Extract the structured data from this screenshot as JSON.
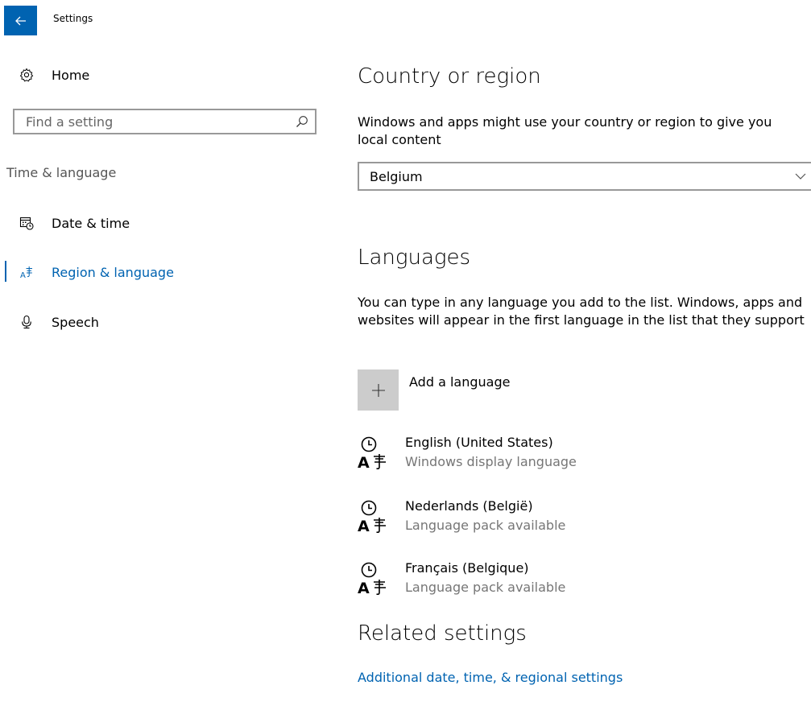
{
  "window": {
    "title": "Settings"
  },
  "nav": {
    "home_label": "Home",
    "search_placeholder": "Find a setting",
    "search_value": "",
    "group_label": "Time & language",
    "items": [
      {
        "label": "Date & time",
        "icon": "calendar-clock-icon",
        "selected": false
      },
      {
        "label": "Region & language",
        "icon": "region-language-icon",
        "selected": true
      },
      {
        "label": "Speech",
        "icon": "microphone-icon",
        "selected": false
      }
    ]
  },
  "region": {
    "heading": "Country or region",
    "description": "Windows and apps might use your country or region to give you local content",
    "selected_country": "Belgium"
  },
  "languages": {
    "heading": "Languages",
    "description": "You can type in any language you add to the list. Windows, apps and websites will appear in the first language in the list that they support",
    "add_label": "Add a language",
    "items": [
      {
        "name": "English (United States)",
        "status": "Windows display language"
      },
      {
        "name": "Nederlands (België)",
        "status": "Language pack available"
      },
      {
        "name": "Français (Belgique)",
        "status": "Language pack available"
      }
    ]
  },
  "related": {
    "heading": "Related settings",
    "link": "Additional date, time, & regional settings"
  },
  "colors": {
    "accent": "#0063b1",
    "secondary_text": "#767676",
    "border": "#999999",
    "tile": "#cccccc"
  }
}
